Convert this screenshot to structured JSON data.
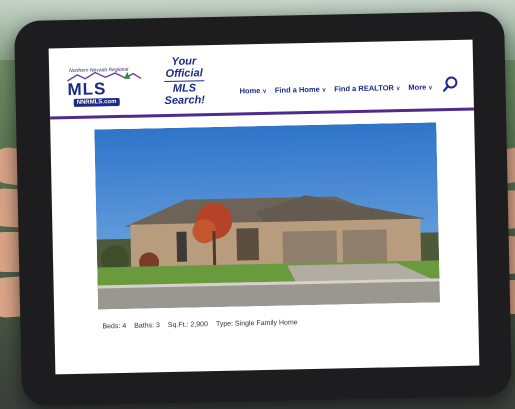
{
  "logo": {
    "region": "Northern Nevada Regional",
    "mark": "MLS",
    "url": "NNRMLS.com"
  },
  "tagline": [
    "Your",
    "Official",
    "MLS",
    "Search!"
  ],
  "nav": [
    {
      "label": "Home"
    },
    {
      "label": "Find a Home"
    },
    {
      "label": "Find a REALTOR"
    },
    {
      "label": "More"
    }
  ],
  "listing": {
    "beds": "Beds: 4",
    "baths": "Baths: 3",
    "sqft": "Sq.Ft.: 2,900",
    "type": "Type: Single Family Home"
  },
  "colors": {
    "brand_blue": "#1b2a88",
    "accent_purple": "#4f2a8f"
  },
  "icons": {
    "search": "search-icon",
    "chevron": "chevron-down-icon"
  }
}
